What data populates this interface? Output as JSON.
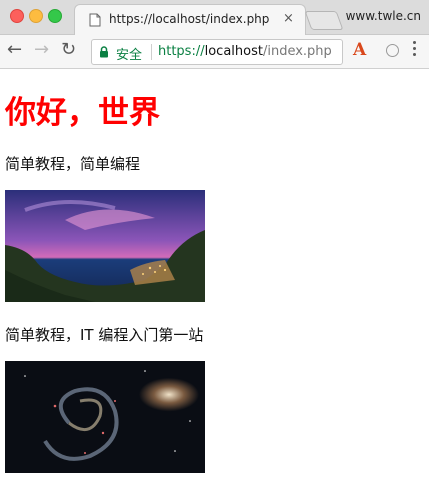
{
  "browser": {
    "tab_title": "https://localhost/index.php",
    "tab_close": "×",
    "profile_label": "www.twle.cn",
    "security_label": "安全",
    "url_scheme": "https://",
    "url_host": "localhost",
    "url_path": "/index.php",
    "back_glyph": "←",
    "forward_glyph": "→",
    "reload_glyph": "↻",
    "extension_letter": "A",
    "icons": [
      "page-icon",
      "lock-icon",
      "extension-icon",
      "kebab-menu-icon"
    ]
  },
  "page": {
    "heading": "你好，世界",
    "para1": "简单教程，简单编程",
    "para2": "简单教程，IT 编程入门第一站",
    "images": [
      {
        "name": "coastal-city-night-photo",
        "colors": [
          "#2b2f7a",
          "#c64fb0",
          "#1b3d7a",
          "#2f4a2b"
        ]
      },
      {
        "name": "whirlpool-galaxy-photo",
        "colors": [
          "#0a0d14",
          "#c8c2b6",
          "#c04a4a",
          "#2e4a78"
        ]
      }
    ]
  },
  "colors": {
    "heading": "#ff0000",
    "secure_green": "#0b8043"
  }
}
